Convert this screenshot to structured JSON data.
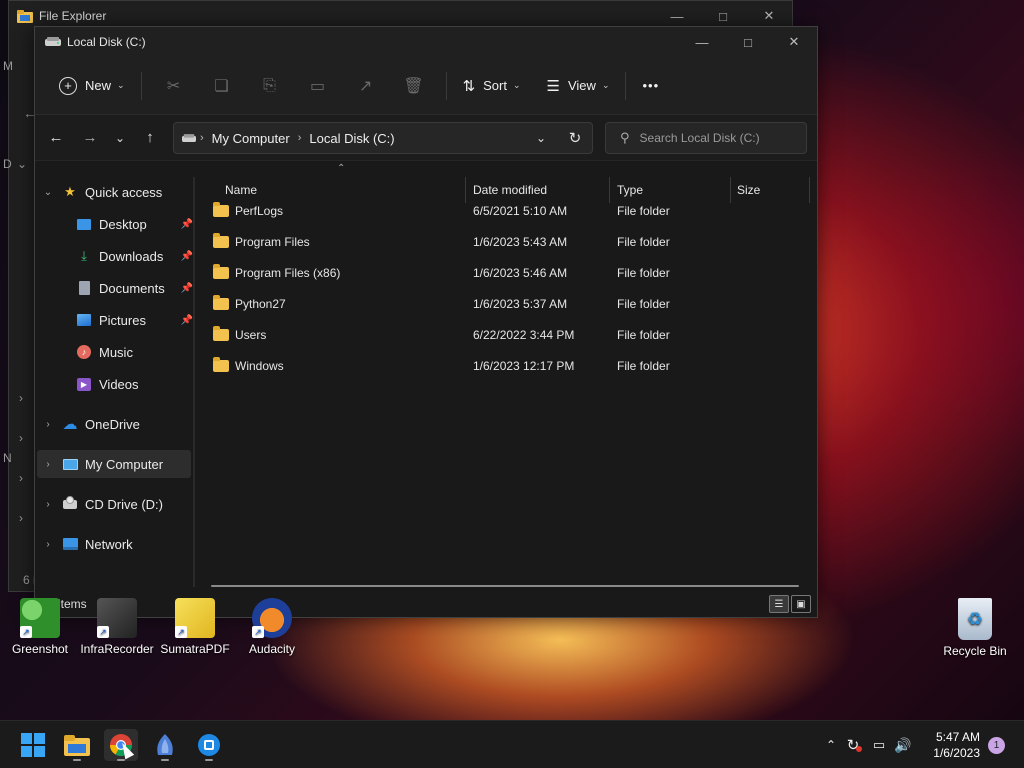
{
  "back_window": {
    "title": "File Explorer",
    "side_labels": [
      "M",
      "D",
      "N",
      "6 i"
    ]
  },
  "window": {
    "title": "Local Disk (C:)",
    "toolbar": {
      "new_label": "New",
      "sort_label": "Sort",
      "view_label": "View",
      "more_label": "•••"
    },
    "address": {
      "root": "My Computer",
      "current": "Local Disk (C:)"
    },
    "search": {
      "placeholder": "Search Local Disk (C:)"
    },
    "sidebar": {
      "quick_access": "Quick access",
      "items": [
        {
          "label": "Desktop",
          "icon": "desktop-icon",
          "pinned": true
        },
        {
          "label": "Downloads",
          "icon": "download-icon",
          "pinned": true
        },
        {
          "label": "Documents",
          "icon": "document-icon",
          "pinned": true
        },
        {
          "label": "Pictures",
          "icon": "pictures-icon",
          "pinned": true
        },
        {
          "label": "Music",
          "icon": "music-icon",
          "pinned": false
        },
        {
          "label": "Videos",
          "icon": "videos-icon",
          "pinned": false
        }
      ],
      "onedrive": "OneDrive",
      "my_computer": "My Computer",
      "cd_drive": "CD Drive (D:)",
      "network": "Network"
    },
    "columns": {
      "name": "Name",
      "date": "Date modified",
      "type": "Type",
      "size": "Size"
    },
    "rows": [
      {
        "name": "PerfLogs",
        "date": "6/5/2021 5:10 AM",
        "type": "File folder"
      },
      {
        "name": "Program Files",
        "date": "1/6/2023 5:43 AM",
        "type": "File folder"
      },
      {
        "name": "Program Files (x86)",
        "date": "1/6/2023 5:46 AM",
        "type": "File folder"
      },
      {
        "name": "Python27",
        "date": "1/6/2023 5:37 AM",
        "type": "File folder"
      },
      {
        "name": "Users",
        "date": "6/22/2022 3:44 PM",
        "type": "File folder"
      },
      {
        "name": "Windows",
        "date": "1/6/2023 12:17 PM",
        "type": "File folder"
      }
    ],
    "status": {
      "count": "6 items"
    }
  },
  "desktop": {
    "icons": [
      {
        "label": "Greenshot",
        "color": "#3aa13a"
      },
      {
        "label": "InfraRecorder",
        "color": "#3a3a3a"
      },
      {
        "label": "SumatraPDF",
        "color": "#f5d23a"
      },
      {
        "label": "Audacity",
        "color": "#e0702a"
      }
    ],
    "recycle_bin": "Recycle Bin"
  },
  "taskbar": {
    "time": "5:47 AM",
    "date": "1/6/2023",
    "notification_count": "1"
  }
}
